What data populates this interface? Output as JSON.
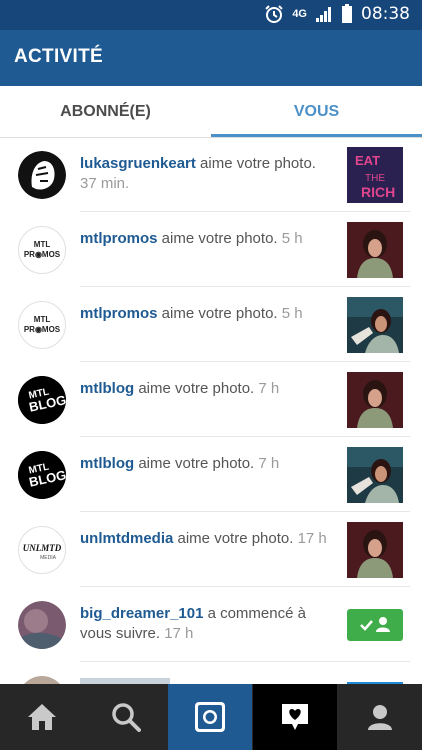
{
  "status_bar": {
    "network": "4G",
    "time": "08:38",
    "icons": [
      "alarm-icon",
      "network-4g-icon",
      "signal-icon",
      "battery-icon"
    ]
  },
  "header": {
    "title": "ACTIVITÉ"
  },
  "tabs": [
    {
      "label": "ABONNÉ(E)",
      "active": false
    },
    {
      "label": "VOUS",
      "active": true
    }
  ],
  "activity": [
    {
      "user": "lukasgruenkeart",
      "action": " aime votre photo. ",
      "time": "37 min.",
      "avatar_text": ""
    },
    {
      "user": "mtlpromos",
      "action": " aime votre photo. ",
      "time": "5 h",
      "avatar_text": "MTL PROMOS"
    },
    {
      "user": "mtlpromos",
      "action": " aime votre photo. ",
      "time": "5 h",
      "avatar_text": "MTL PROMOS"
    },
    {
      "user": "mtlblog",
      "action": " aime votre photo. ",
      "time": "7 h",
      "avatar_text": "MTL BLOG"
    },
    {
      "user": "mtlblog",
      "action": " aime votre photo. ",
      "time": "7 h",
      "avatar_text": "MTL BLOG"
    },
    {
      "user": "unlmtdmedia",
      "action": " aime votre photo. ",
      "time": "17 h",
      "avatar_text": "UNLMTD"
    },
    {
      "user": "big_dreamer_101",
      "action": " a commencé à vous suivre. ",
      "time": "17 h",
      "avatar_text": ""
    }
  ],
  "colors": {
    "status_bar": "#16467a",
    "app_bar": "#1f5b92",
    "active_tab": "#4c90c8",
    "username": "#1f5b92",
    "follow_button": "#3fae4a",
    "bottom_bar": "#272727"
  },
  "bottom_nav": [
    "home-icon",
    "search-icon",
    "camera-icon",
    "activity-heart-icon",
    "profile-icon"
  ]
}
